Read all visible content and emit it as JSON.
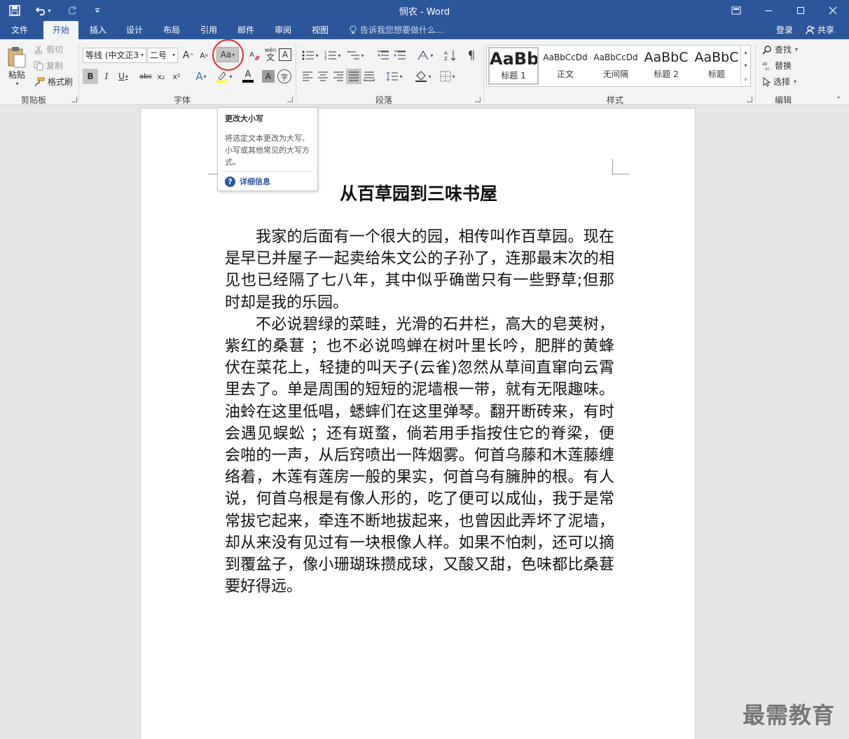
{
  "window": {
    "title": "悯农 - Word"
  },
  "tabs": [
    "文件",
    "开始",
    "插入",
    "设计",
    "布局",
    "引用",
    "邮件",
    "审阅",
    "视图"
  ],
  "tell_me": "告诉我您想要做什么...",
  "account": {
    "login": "登录",
    "share": "共享"
  },
  "clipboard": {
    "paste": "粘贴",
    "cut": "剪切",
    "copy": "复制",
    "format_painter": "格式刷",
    "label": "剪贴板"
  },
  "font": {
    "name": "等线 (中文正3",
    "size": "二号",
    "grow": "A",
    "shrink": "A",
    "change_case": "Aa",
    "bold": "B",
    "italic": "I",
    "underline": "U",
    "strike": "abc",
    "subscript": "x₂",
    "superscript": "x²",
    "wen": "wén",
    "text_effect": "A",
    "font_color": "A",
    "shading": "A",
    "enclose": "字",
    "label": "字体"
  },
  "paragraph": {
    "label": "段落"
  },
  "styles": {
    "items": [
      {
        "preview": "AaBb",
        "name": "标题 1"
      },
      {
        "preview": "AaBbCcDd",
        "name": "正文"
      },
      {
        "preview": "AaBbCcDd",
        "name": "无间隔"
      },
      {
        "preview": "AaBbC",
        "name": "标题 2"
      },
      {
        "preview": "AaBbC",
        "name": "标题"
      }
    ],
    "label": "样式"
  },
  "editing": {
    "find": "查找",
    "replace": "替换",
    "select": "选择",
    "label": "编辑"
  },
  "tooltip": {
    "title": "更改大小写",
    "desc": "将选定文本更改为大写、小写或其他常见的大写方式。",
    "more": "详细信息"
  },
  "document": {
    "title": "从百草园到三味书屋",
    "paragraphs": [
      "我家的后面有一个很大的园，相传叫作百草园。现在是早已并屋子一起卖给朱文公的子孙了，连那最末次的相见也已经隔了七八年，其中似乎确凿只有一些野草;但那时却是我的乐园。",
      "不必说碧绿的菜畦，光滑的石井栏，高大的皂荚树，紫红的桑葚 ；也不必说鸣蝉在树叶里长吟，肥胖的黄蜂伏在菜花上，轻捷的叫天子(云雀)忽然从草间直窜向云霄里去了。单是周围的短短的泥墙根一带，就有无限趣味。油蛉在这里低唱，蟋蟀们在这里弹琴。翻开断砖来，有时会遇见蜈蚣 ；还有斑蝥，倘若用手指按住它的脊梁，便会啪的一声，从后窍喷出一阵烟雾。何首乌藤和木莲藤缠络着，木莲有莲房一般的果实，何首乌有臃肿的根。有人说，何首乌根是有像人形的，吃了便可以成仙，我于是常常拔它起来，牵连不断地拔起来，也曾因此弄坏了泥墙，却从来没有见过有一块根像人样。如果不怕刺，还可以摘到覆盆子，像小珊瑚珠攒成球，又酸又甜，色味都比桑葚要好得远。"
    ]
  },
  "watermark": "最需教育"
}
